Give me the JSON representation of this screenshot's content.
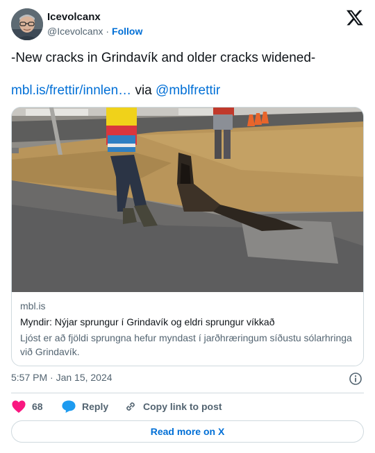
{
  "author": {
    "name": "Icevolcanx",
    "handle": "@Icevolcanx",
    "separator": "·",
    "follow_label": "Follow"
  },
  "tweet": {
    "text": "-New cracks in Grindavík and older cracks widened-",
    "link_text": "mbl.is/frettir/innlen…",
    "via_text": " via ",
    "mention": "@mblfrettir"
  },
  "card": {
    "domain": "mbl.is",
    "title": "Myndir: Nýjar sprungur í Grindavík og eldri sprungur víkkað",
    "description": "Ljóst er að fjöldi sprungna hefur myndast í jarðhræringum síðustu sólarhringa við Grindavík."
  },
  "meta": {
    "timestamp": "5:57 PM · Jan 15, 2024"
  },
  "actions": {
    "like_count": "68",
    "reply_label": "Reply",
    "copy_label": "Copy link to post"
  },
  "read_more_label": "Read more on X",
  "colors": {
    "accent": "#006fd6",
    "like": "#f91880",
    "text": "#0f1419",
    "muted": "#536471",
    "border": "#cfd9de"
  },
  "icons": [
    "x-logo-icon",
    "info-icon",
    "heart-icon",
    "reply-bubble-icon",
    "link-icon"
  ]
}
